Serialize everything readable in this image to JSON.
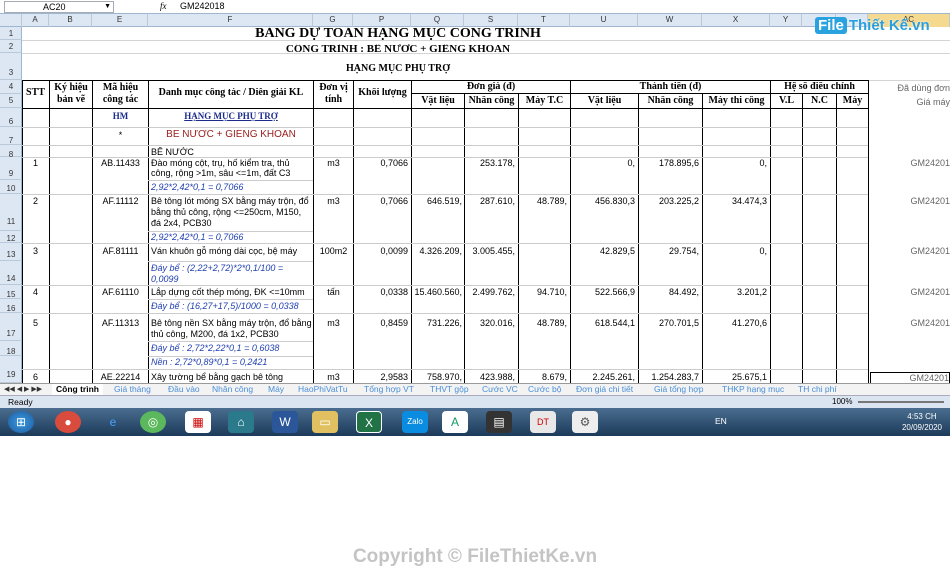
{
  "formula_bar": {
    "name_box": "AC20",
    "fx": "fx",
    "value": "GM242018"
  },
  "logo": {
    "file": "File",
    "rest": "Thiết Kế.vn"
  },
  "columns": [
    "A",
    "B",
    "E",
    "F",
    "G",
    "P",
    "Q",
    "S",
    "T",
    "U",
    "W",
    "X",
    "Y",
    "",
    "",
    "AC"
  ],
  "rows": [
    "1",
    "2",
    "3",
    "4",
    "5",
    "6",
    "7",
    "8",
    "9",
    "10",
    "11",
    "12",
    "13",
    "14",
    "15",
    "16",
    "17",
    "18",
    "19"
  ],
  "title": "BẢNG DỰ TOÁN HẠNG MỤC CÔNG TRÌNH",
  "project": "CÔNG TRÌNH : BỂ NƯỚC + GIẾNG KHOAN",
  "item_group": "HẠNG MỤC PHỤ TRỢ",
  "headers": {
    "stt": "STT",
    "ky_hieu": "Ký hiệu bản vẽ",
    "ma_hieu": "Mã hiệu công tác",
    "danh_muc": "Danh mục công tác / Diễn giải KL",
    "don_vi": "Đơn vị tính",
    "khoi_luong": "Khối lượng",
    "don_gia": "Đơn giá (đ)",
    "thanh_tien": "Thành tiền (đ)",
    "he_so": "Hệ số điều chỉnh",
    "vat_lieu": "Vật liệu",
    "nhan_cong": "Nhân công",
    "may_tc": "Máy T.C",
    "vat_lieu2": "Vật liệu",
    "nhan_cong2": "Nhân công",
    "may_thi_cong": "Máy thi công",
    "vl": "V.L",
    "nc": "N.C",
    "may": "Máy",
    "da_dung": "Đã dùng đơn",
    "gia_may": "Giá máy"
  },
  "row6": {
    "code": "HM",
    "desc": "HẠNG MỤC PHỤ TRỢ"
  },
  "row7": {
    "code": "*",
    "desc": "BỂ NƯỚC + GIẾNG KHOAN"
  },
  "row8": {
    "desc": "BỂ NƯỚC"
  },
  "items": [
    {
      "stt": "1",
      "code": "AB.11433",
      "desc1": "Đào móng cột, trụ, hố kiểm tra, thủ",
      "desc2": "công, rộng >1m, sâu <=1m, đất C3",
      "desc3": "",
      "unit": "m3",
      "kl": "0,7066",
      "vl": "",
      "nc": "253.178,",
      "mtc": "",
      "tvl": "0,",
      "tnc": "178.895,6",
      "tm": "0,",
      "gm": "GM24201",
      "formula": "2,92*2,42*0,1 = 0,7066"
    },
    {
      "stt": "2",
      "code": "AF.11112",
      "desc1": "Bê tông lót móng SX bằng máy trộn, đổ",
      "desc2": "bằng thủ công, rộng <=250cm, M150,",
      "desc3": "đá 2x4, PCB30",
      "unit": "m3",
      "kl": "0,7066",
      "vl": "646.519,",
      "nc": "287.610,",
      "mtc": "48.789,",
      "tvl": "456.830,3",
      "tnc": "203.225,2",
      "tm": "34.474,3",
      "gm": "GM24201",
      "formula": "2,92*2,42*0,1 = 0,7066"
    },
    {
      "stt": "3",
      "code": "AF.81111",
      "desc1": "Ván khuôn gỗ móng dài cọc, bệ máy",
      "desc2": "",
      "desc3": "",
      "unit": "100m2",
      "kl": "0,0099",
      "vl": "4.326.209,",
      "nc": "3.005.455,",
      "mtc": "",
      "tvl": "42.829,5",
      "tnc": "29.754,",
      "tm": "0,",
      "gm": "GM24201",
      "formula": "Đáy bể : (2,22+2,72)*2*0,1/100 =",
      "formula2": "0,0099"
    },
    {
      "stt": "4",
      "code": "AF.61110",
      "desc1": "Lắp dựng cốt thép móng, ĐK <=10mm",
      "desc2": "",
      "desc3": "",
      "unit": "tấn",
      "kl": "0,0338",
      "vl": "15.460.560,",
      "nc": "2.499.762,",
      "mtc": "94.710,",
      "tvl": "522.566,9",
      "tnc": "84.492,",
      "tm": "3.201,2",
      "gm": "GM24201",
      "formula": "Đáy bể : (16,27+17,5)/1000 = 0,0338"
    },
    {
      "stt": "5",
      "code": "AF.11313",
      "desc1": "Bê tông nền SX bằng máy trộn, đổ bằng",
      "desc2": "thủ công, M200, đá 1x2, PCB30",
      "desc3": "",
      "unit": "m3",
      "kl": "0,8459",
      "vl": "731.226,",
      "nc": "320.016,",
      "mtc": "48.789,",
      "tvl": "618.544,1",
      "tnc": "270.701,5",
      "tm": "41.270,6",
      "gm": "GM24201",
      "formula": "Đáy bể : 2,72*2,22*0,1 = 0,6038",
      "formula2": "Nền : 2,72*0,89*0,1 = 0,2421"
    },
    {
      "stt": "6",
      "code": "AE.22214",
      "desc1": "Xây tường bể bằng gạch bê tông",
      "desc2": "",
      "desc3": "",
      "unit": "m3",
      "kl": "2,9583",
      "vl": "758.970,",
      "nc": "423.988,",
      "mtc": "8.679,",
      "tvl": "2.245.261,",
      "tnc": "1.254.283,7",
      "tm": "25.675,1",
      "gm": "GM24201"
    }
  ],
  "tabs": [
    "Công trình",
    "Giá tháng",
    "Đầu vào",
    "Nhân công",
    "Máy",
    "HaoPhiVatTu",
    "Tổng hợp VT",
    "THVT gộp",
    "Cước VC",
    "Cước bộ",
    "Đơn giá chi tiết",
    "Giá tổng hợp",
    "THKP hạng mục",
    "TH chi phí"
  ],
  "status": {
    "ready": "Ready",
    "zoom": "100%"
  },
  "taskbar": {
    "lang": "EN",
    "time": "4:53 CH",
    "date": "20/09/2020"
  },
  "copyright": "Copyright © FileThietKe.vn"
}
